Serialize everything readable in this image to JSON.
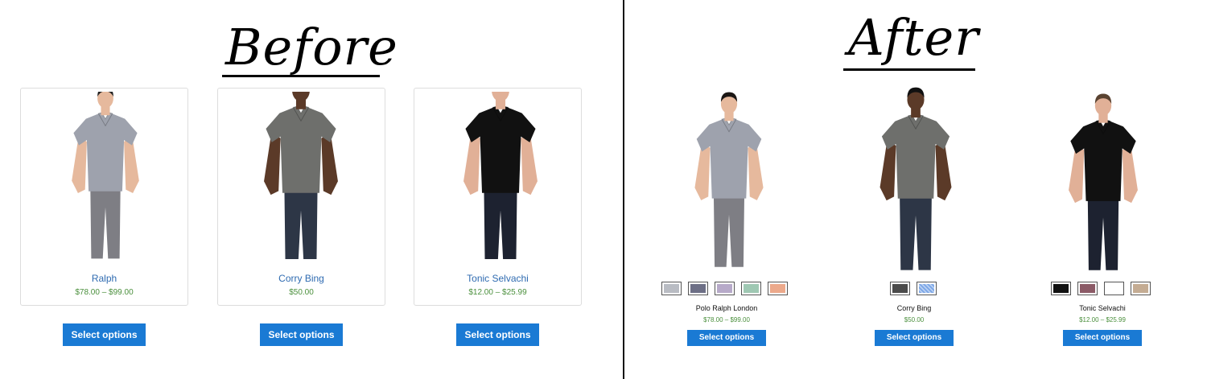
{
  "before": {
    "heading": "Before",
    "products": [
      {
        "name": "Ralph",
        "price": "$78.00 – $99.00",
        "button": "Select options",
        "shirt": "#9ea2ad",
        "pants": "#7e7e84",
        "skin": "#e6b99d"
      },
      {
        "name": "Corry Bing",
        "price": "$50.00",
        "button": "Select options",
        "shirt": "#6e6f6c",
        "pants": "#2d3646",
        "skin": "#5b3a28"
      },
      {
        "name": "Tonic Selvachi",
        "price": "$12.00 – $25.99",
        "button": "Select options",
        "shirt": "#111111",
        "pants": "#1d2230",
        "skin": "#e1b097"
      }
    ]
  },
  "after": {
    "heading": "After",
    "products": [
      {
        "name": "Polo Ralph London",
        "price": "$78.00 – $99.00",
        "button": "Select options",
        "shirt": "#9ea2ad",
        "pants": "#7e7e84",
        "skin": "#e6b99d",
        "hair": "#1b1715",
        "swatches": [
          "#b9bcc3",
          "#6d6f86",
          "#b7aac9",
          "#9fc8b3",
          "#eca98b"
        ]
      },
      {
        "name": "Corry Bing",
        "price": "$50.00",
        "button": "Select options",
        "shirt": "#6e6f6c",
        "pants": "#2d3646",
        "skin": "#5b3a28",
        "hair": "#111111",
        "swatches": [
          "#4b4b4b",
          "#b9d0f2"
        ]
      },
      {
        "name": "Tonic Selvachi",
        "price": "$12.00 – $25.99",
        "button": "Select options",
        "shirt": "#111111",
        "pants": "#1d2230",
        "skin": "#e1b097",
        "hair": "#5a4331",
        "swatches": [
          "#111111",
          "#8b5a66",
          "#ffffff",
          "#c4ac93"
        ]
      }
    ]
  }
}
